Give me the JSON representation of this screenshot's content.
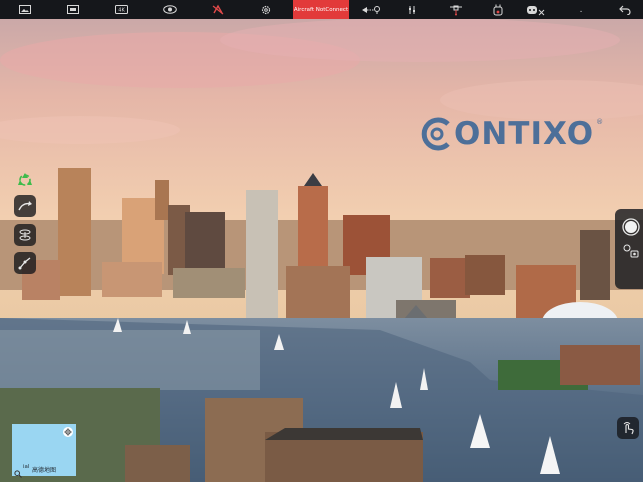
{
  "toolbar": {
    "icons": [
      "gallery-icon",
      "camera-settings-icon",
      "video-resolution-icon",
      "view-icon",
      "no-gps-icon",
      "settings-gear-icon"
    ],
    "status": "Aircraft NotConnect",
    "right_icons": [
      "route-icon",
      "sliders-icon",
      "drone-icon",
      "remote-controller-icon",
      "controller-disconnected-icon",
      "signal-icon",
      "back-icon"
    ],
    "signal_text": "."
  },
  "brand": {
    "logo_text": "ONTIXO",
    "logo_mark": "C",
    "registered": "®"
  },
  "map": {
    "label": "高德地图",
    "mini_label": "ial"
  },
  "colors": {
    "toolbar_bg": "#15171b",
    "status_bg": "#e23a3a",
    "logo": "#4d6f99",
    "recycle": "#3dbb4a"
  }
}
